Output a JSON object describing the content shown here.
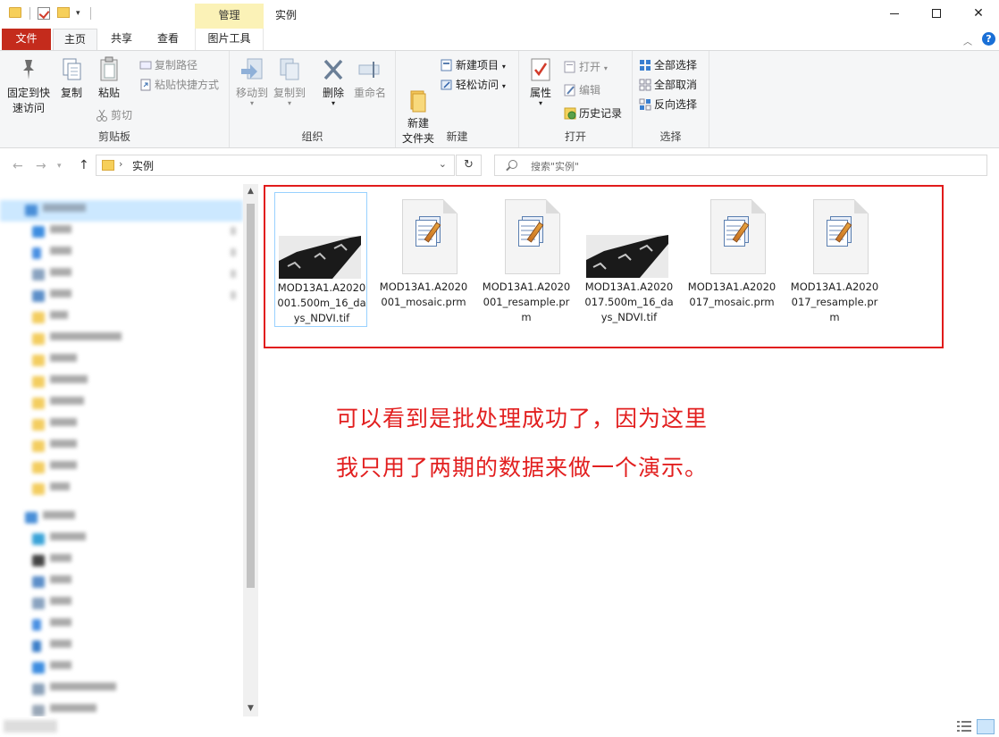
{
  "window": {
    "title": "实例",
    "manage_label": "管理",
    "qa_dropdown": "▾"
  },
  "tabs": {
    "file": "文件",
    "home": "主页",
    "share": "共享",
    "view": "查看",
    "picture_tools": "图片工具"
  },
  "ribbon": {
    "clipboard": {
      "label": "剪贴板",
      "pin": "固定到快速访问",
      "copy": "复制",
      "paste": "粘贴",
      "copy_path": "复制路径",
      "paste_shortcut": "粘贴快捷方式",
      "cut": "剪切"
    },
    "organize": {
      "label": "组织",
      "move_to": "移动到",
      "copy_to": "复制到",
      "delete": "删除",
      "rename": "重命名"
    },
    "new": {
      "label": "新建",
      "new_folder": "新建\n文件夹",
      "new_item": "新建项目",
      "easy_access": "轻松访问"
    },
    "open": {
      "label": "打开",
      "properties": "属性",
      "open": "打开",
      "edit": "编辑",
      "history": "历史记录"
    },
    "select": {
      "label": "选择",
      "select_all": "全部选择",
      "select_none": "全部取消",
      "invert": "反向选择"
    }
  },
  "address": {
    "path": "实例",
    "search_placeholder": "搜索\"实例\""
  },
  "files": [
    {
      "name": "MOD13A1.A2020001.500m_16_days_NDVI.tif",
      "type": "tif",
      "selected": true
    },
    {
      "name": "MOD13A1.A2020001_mosaic.prm",
      "type": "prm",
      "selected": false
    },
    {
      "name": "MOD13A1.A2020001_resample.prm",
      "type": "prm",
      "selected": false
    },
    {
      "name": "MOD13A1.A2020017.500m_16_days_NDVI.tif",
      "type": "tif",
      "selected": false
    },
    {
      "name": "MOD13A1.A2020017_mosaic.prm",
      "type": "prm",
      "selected": false
    },
    {
      "name": "MOD13A1.A2020017_resample.prm",
      "type": "prm",
      "selected": false
    }
  ],
  "annotation": {
    "line1": "可以看到是批处理成功了，因为这里",
    "line2": "我只用了两期的数据来做一个演示。"
  },
  "colors": {
    "accent_red": "#e11b1b",
    "file_tab": "#c42b1c",
    "manage_tab": "#fbf2b7",
    "selection": "#cce8ff"
  }
}
